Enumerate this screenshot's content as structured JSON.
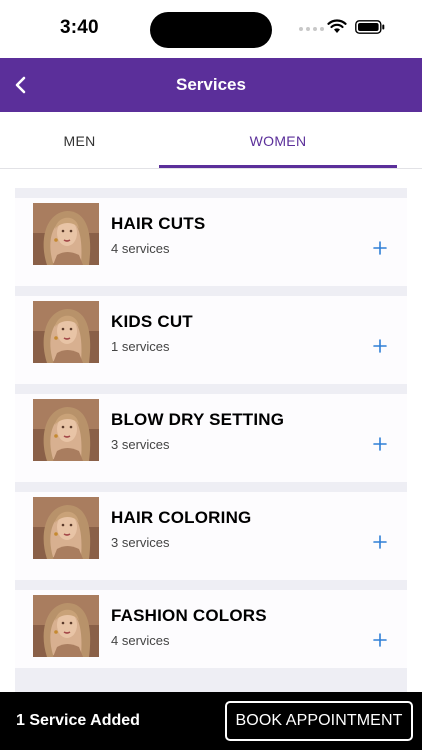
{
  "status_bar": {
    "time": "3:40"
  },
  "header": {
    "title": "Services",
    "back_icon": "chevron-left-icon"
  },
  "tabs": [
    {
      "label": "MEN",
      "selected": false
    },
    {
      "label": "WOMEN",
      "selected": true
    }
  ],
  "categories": [
    {
      "title": "HAIR CUTS",
      "count": "4 services"
    },
    {
      "title": "KIDS CUT",
      "count": "1 services"
    },
    {
      "title": "BLOW DRY SETTING",
      "count": "3 services"
    },
    {
      "title": "HAIR COLORING",
      "count": "3 services"
    },
    {
      "title": "FASHION COLORS",
      "count": "4 services"
    }
  ],
  "footer": {
    "added_text": "1 Service Added",
    "book_button": "BOOK APPOINTMENT"
  },
  "colors": {
    "brand": "#5b2f9a",
    "add_icon": "#2f7fd6",
    "separator": "#eeeef4",
    "footer_bg": "#000000"
  }
}
